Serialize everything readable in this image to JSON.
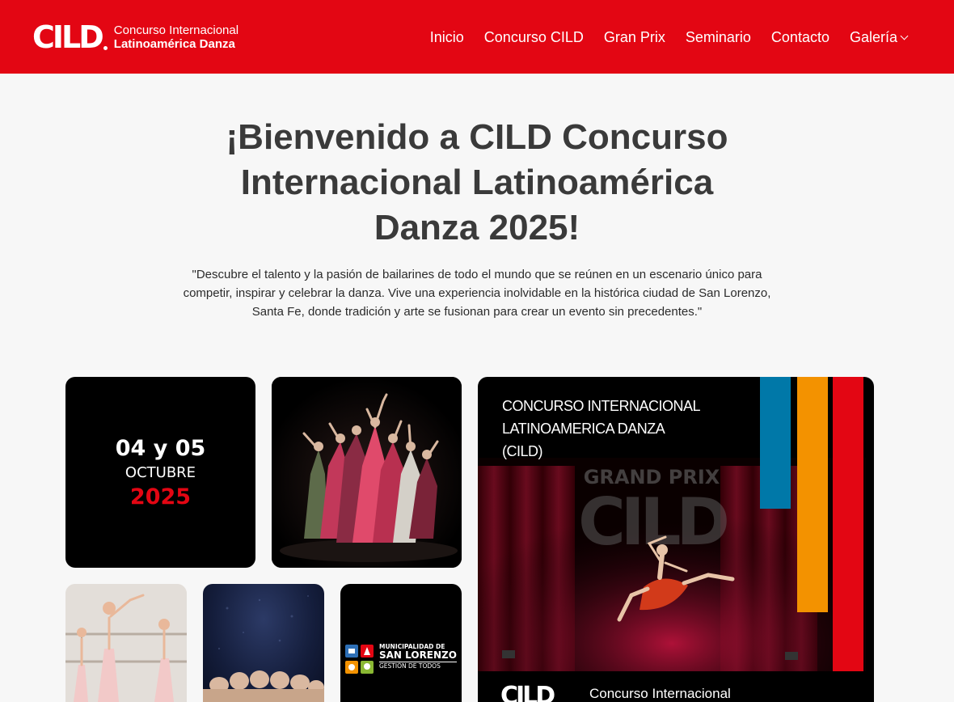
{
  "header": {
    "logo_mark": "CILD",
    "logo_line1": "Concurso Internacional",
    "logo_line2": "Latinoamérica Danza",
    "nav": [
      {
        "label": "Inicio"
      },
      {
        "label": "Concurso CILD"
      },
      {
        "label": "Gran Prix"
      },
      {
        "label": "Seminario"
      },
      {
        "label": "Contacto"
      },
      {
        "label": "Galería",
        "has_dropdown": true
      }
    ]
  },
  "hero": {
    "title": "¡Bienvenido a CILD Concurso Internacional Latinoamérica Danza 2025!",
    "description": "\"Descubre el talento y la pasión de bailarines de todo el mundo que se reúnen en un escenario único para competir, inspirar y celebrar la danza. Vive una experiencia inolvidable en la histórica ciudad de San Lorenzo, Santa Fe, donde tradición y arte se fusionan para crear un evento sin precedentes.\""
  },
  "date_tile": {
    "days": "04 y 05",
    "month": "OCTUBRE",
    "year": "2025"
  },
  "poster": {
    "title_line1": "CONCURSO INTERNACIONAL",
    "title_line2": "LATINOAMERICA DANZA",
    "title_line3": "(CILD)",
    "watermark_top": "GRAND PRIX",
    "watermark_mark": "CILD",
    "footer_mark": "CILD",
    "footer_text": "Concurso Internacional"
  },
  "municipality": {
    "line1": "MUNICIPALIDAD DE",
    "line2": "SAN LORENZO",
    "line3": "GESTIÓN DE TODOS"
  },
  "colors": {
    "brand_red": "#e30613",
    "page_bg": "#f7f7f7",
    "poster_blue": "#0078a8",
    "poster_orange": "#f39200",
    "poster_red": "#e30613"
  }
}
